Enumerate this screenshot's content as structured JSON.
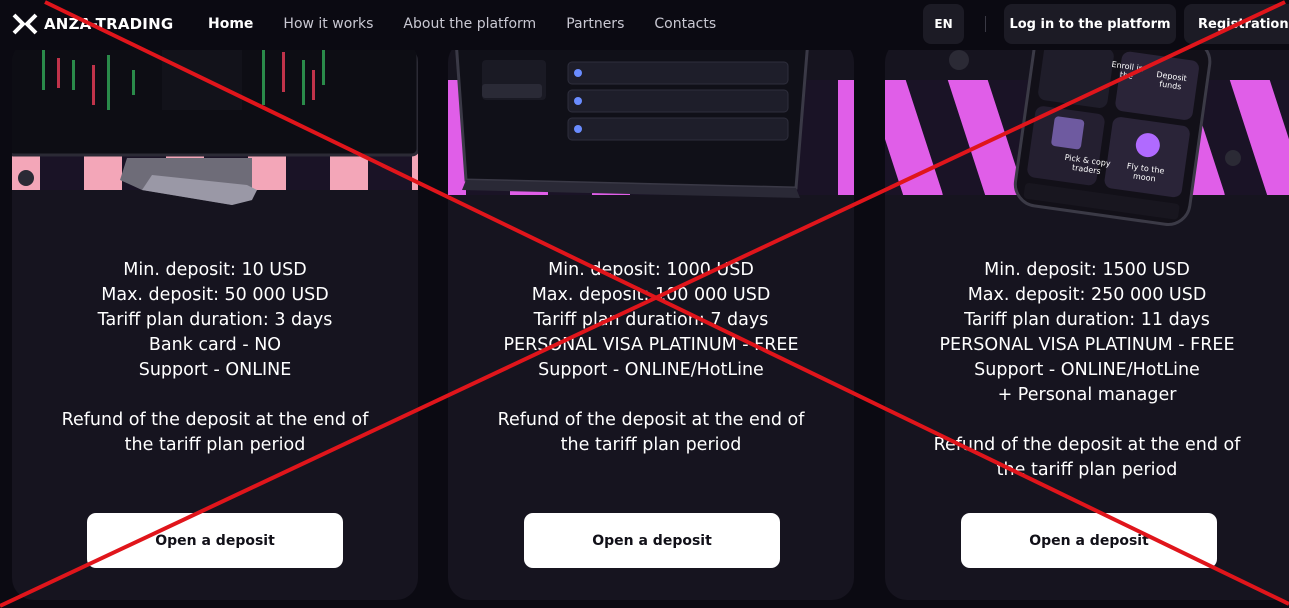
{
  "header": {
    "logo_text": "ANZA-TRADING",
    "nav": [
      {
        "label": "Home",
        "active": true
      },
      {
        "label": "How it works",
        "active": false
      },
      {
        "label": "About the platform",
        "active": false
      },
      {
        "label": "Partners",
        "active": false
      },
      {
        "label": "Contacts",
        "active": false
      }
    ],
    "language": "EN",
    "login_label": "Log in to the platform",
    "register_label": "Registration"
  },
  "cards": [
    {
      "lines": [
        "Min. deposit: 10 USD",
        "Max. deposit: 50 000 USD",
        "Tariff plan duration: 3 days",
        "Bank card - NO",
        "Support - ONLINE"
      ],
      "refund_lines": [
        "Refund of the deposit at the end of",
        "the tariff plan period"
      ],
      "button_label": "Open a deposit"
    },
    {
      "lines": [
        "Min. deposit: 1000 USD",
        "Max. deposit: 100 000 USD",
        "Tariff plan duration: 7 days",
        "PERSONAL VISA PLATINUM - FREE",
        "Support - ONLINE/HotLine"
      ],
      "refund_lines": [
        "Refund of the deposit at the end of",
        "the tariff plan period"
      ],
      "button_label": "Open a deposit"
    },
    {
      "lines": [
        "Min. deposit: 1500 USD",
        "Max. deposit: 250 000 USD",
        "Tariff plan duration: 11 days",
        "PERSONAL VISA PLATINUM - FREE",
        "Support - ONLINE/HotLine",
        "+ Personal manager"
      ],
      "refund_lines": [
        "Refund of the deposit at the end of",
        "the tariff plan period"
      ],
      "button_label": "Open a deposit"
    }
  ],
  "phone_tiles": [
    "Enroll in the",
    "Deposit funds",
    "Pick & copy traders",
    "Fly to the moon"
  ],
  "colors": {
    "background": "#0b0a12",
    "card": "#16141f",
    "stripe_pink": "#f3a6b8",
    "stripe_magenta": "#e05ee8",
    "cross_red": "#e0151b"
  }
}
